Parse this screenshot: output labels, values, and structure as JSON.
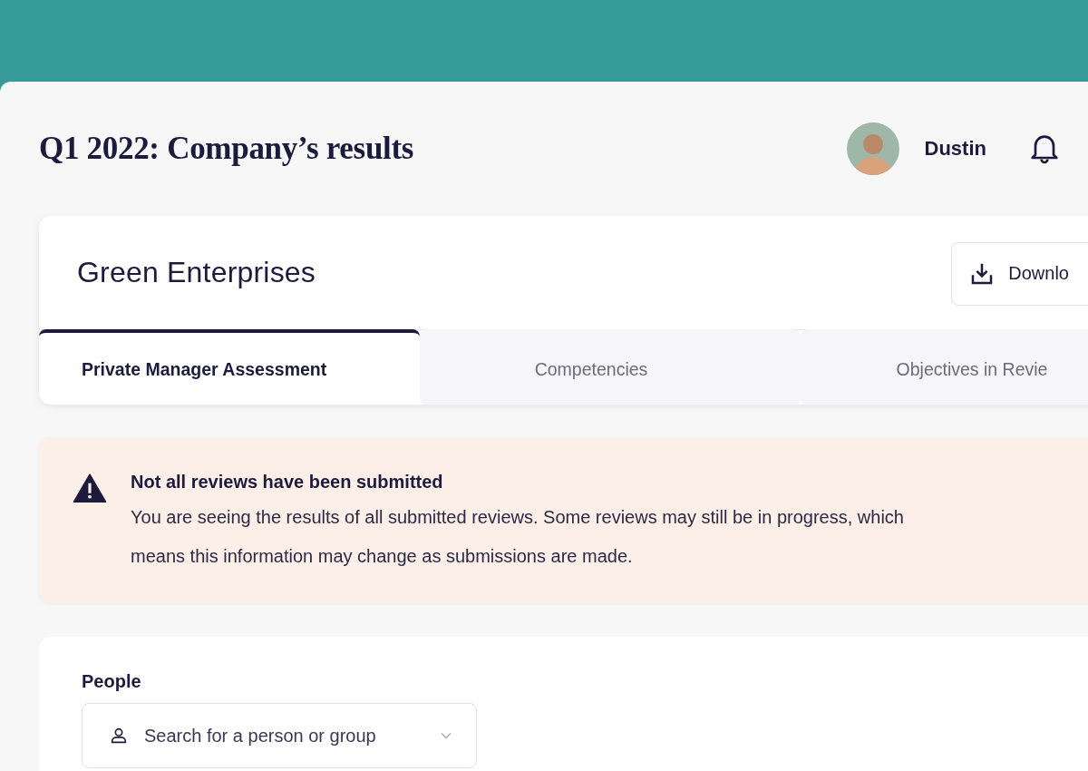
{
  "header": {
    "title": "Q1 2022: Company’s results",
    "user": {
      "name": "Dustin"
    }
  },
  "card": {
    "title": "Green Enterprises",
    "download_button": {
      "label": "Downlo"
    }
  },
  "tabs": [
    {
      "label": "Private Manager Assessment",
      "selected": true
    },
    {
      "label": "Competencies",
      "selected": false
    },
    {
      "label": "Objectives in Revie",
      "selected": false
    }
  ],
  "alert": {
    "title": "Not all reviews have been submitted",
    "message": "You are seeing the results of all submitted reviews. Some reviews may still be in progress, which means this information may change as submissions are made."
  },
  "filters": {
    "people": {
      "label": "People",
      "placeholder": "Search for a person or group"
    }
  }
}
